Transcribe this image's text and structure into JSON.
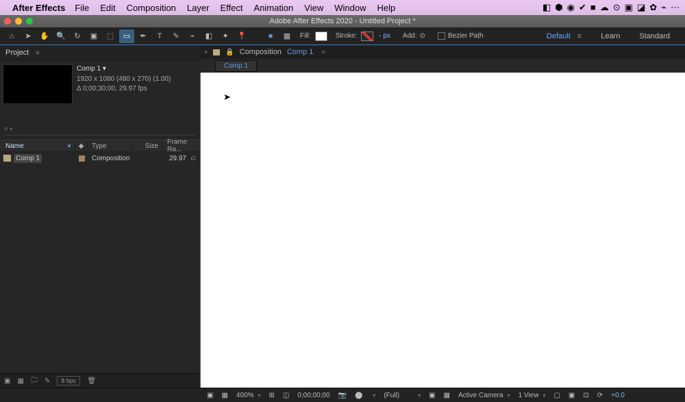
{
  "menubar": {
    "app": "After Effects",
    "items": [
      "File",
      "Edit",
      "Composition",
      "Layer",
      "Effect",
      "Animation",
      "View",
      "Window",
      "Help"
    ]
  },
  "titlebar": {
    "title": "Adobe After Effects 2020 - Untitled Project *"
  },
  "toolbar": {
    "fill_label": "Fill:",
    "stroke_label": "Stroke:",
    "stroke_value": "- px",
    "add_label": "Add:",
    "bezier_label": "Bezier Path",
    "workspaces": {
      "default": "Default",
      "learn": "Learn",
      "standard": "Standard"
    }
  },
  "project": {
    "panel_title": "Project",
    "comp": {
      "name": "Comp 1",
      "dims": "1920 x 1080  (480 x 270) (1.00)",
      "dur": "Δ 0;00;30;00, 29.97 fps"
    },
    "columns": {
      "name": "Name",
      "type": "Type",
      "size": "Size",
      "fr": "Frame Ra..."
    },
    "row": {
      "name": "Comp 1",
      "type": "Composition",
      "size": "",
      "fr": "29.97"
    },
    "bpc": "8 bpc"
  },
  "viewer": {
    "tab_prefix": "Composition",
    "tab_name": "Comp 1",
    "crumb": "Comp 1"
  },
  "status": {
    "zoom": "400%",
    "time": "0;00;00;00",
    "res": "(Full)",
    "camera": "Active Camera",
    "view": "1 View",
    "exposure": "+0.0"
  }
}
